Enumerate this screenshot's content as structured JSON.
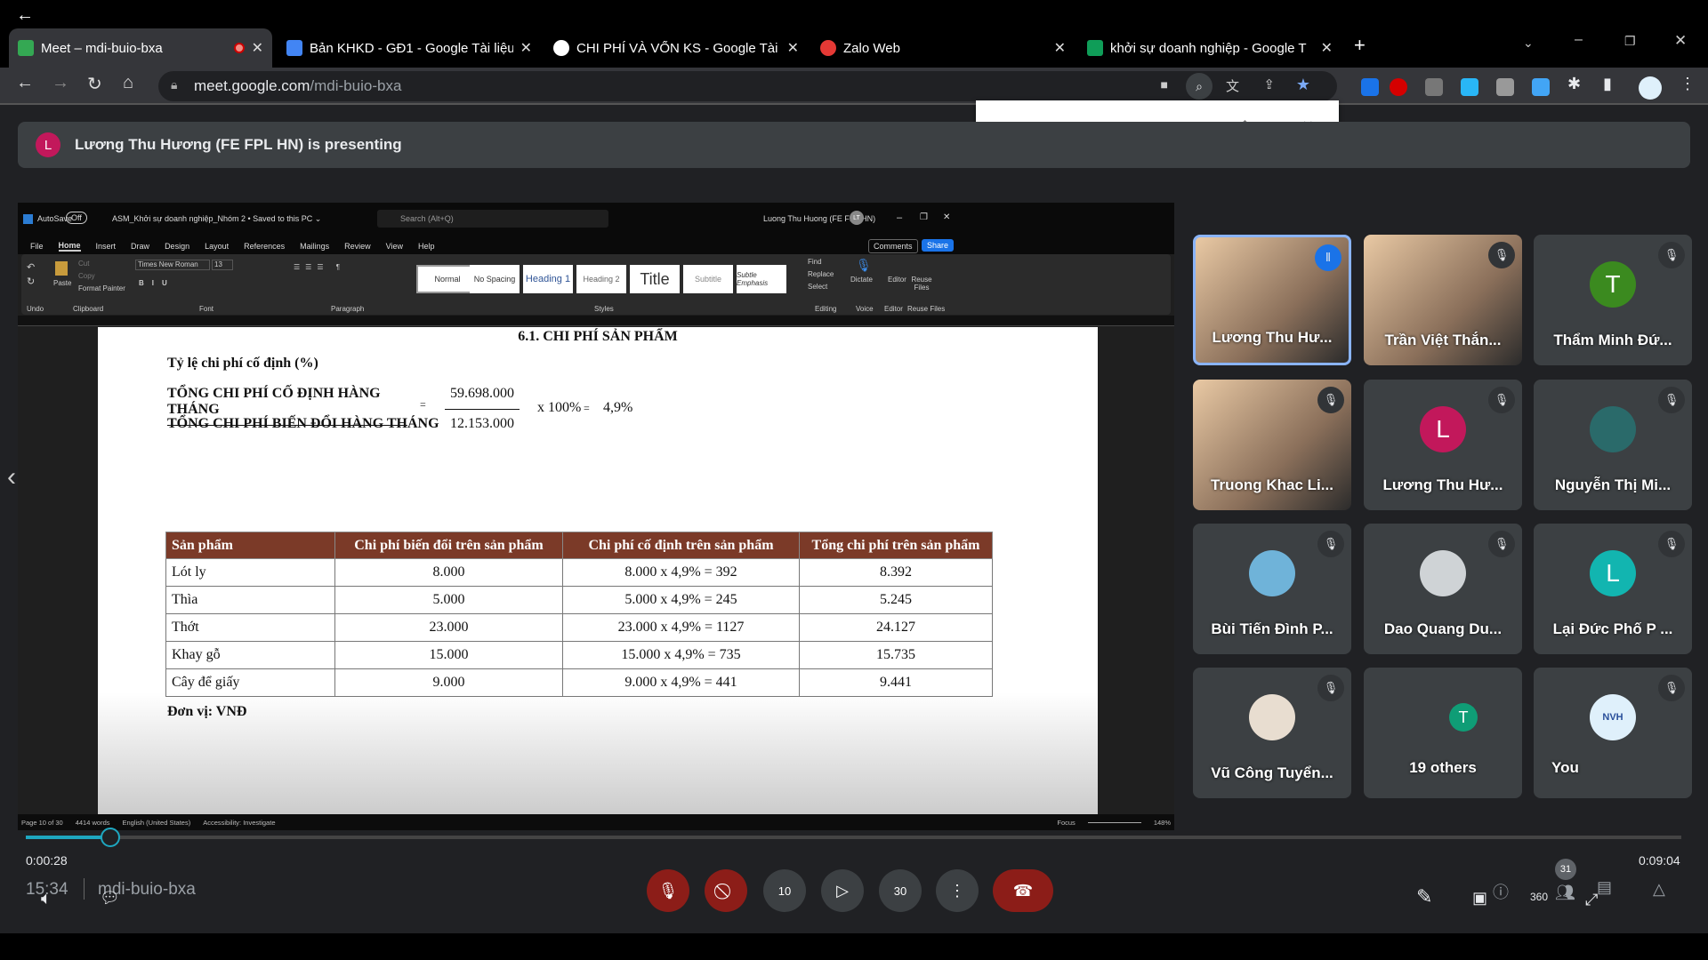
{
  "browser": {
    "tabs": [
      {
        "label": "Meet – mdi-buio-bxa",
        "color": "#34a853",
        "active": true
      },
      {
        "label": "Bản KHKD - GĐ1 - Google Tài liệu",
        "color": "#4285f4"
      },
      {
        "label": "CHI PHÍ VÀ VỐN KS - Google Tài",
        "color": "#ffffff"
      },
      {
        "label": "Zalo Web",
        "color": "#e53935"
      },
      {
        "label": "khởi sự doanh nghiệp - Google T",
        "color": "#0f9d58"
      }
    ],
    "url_host": "meet.google.com",
    "url_path": "/mdi-buio-bxa"
  },
  "banner": {
    "avatar": "L",
    "text": "Lương Thu Hương (FE FPL HN) is presenting"
  },
  "word": {
    "autosave": "AutoSave",
    "autosave_state": "Off",
    "doc_title": "ASM_Khởi sự doanh nghiệp_Nhóm 2 • Saved to this PC ⌄",
    "search": "Search (Alt+Q)",
    "user": "Luong Thu Huong (FE FPL HN)",
    "user_initials": "LT",
    "menu": [
      "File",
      "Home",
      "Insert",
      "Draw",
      "Design",
      "Layout",
      "References",
      "Mailings",
      "Review",
      "View",
      "Help"
    ],
    "comments": "Comments",
    "share": "Share",
    "font": "Times New Roman",
    "size": "13",
    "clipboard": {
      "paste": "Paste",
      "cut": "Cut",
      "copy": "Copy",
      "format_painter": "Format Painter"
    },
    "styles": [
      "Normal",
      "No Spacing",
      "Heading 1",
      "Heading 2",
      "Title",
      "Subtitle",
      "Subtle Emphasis"
    ],
    "editing": [
      "Find",
      "Replace",
      "Select"
    ],
    "voice": "Dictate",
    "editor": "Editor",
    "reuse": "Reuse Files",
    "groups": [
      "Undo",
      "Clipboard",
      "Font",
      "Paragraph",
      "Styles",
      "Editing",
      "Voice",
      "Editor",
      "Reuse Files"
    ],
    "status": {
      "page": "Page 10 of 30",
      "words": "4414 words",
      "lang": "English (United States)",
      "access": "Accessibility: Investigate",
      "focus": "Focus",
      "zoom": "148%"
    }
  },
  "doc": {
    "heading": "6.1. CHI PHÍ SẢN PHẨM",
    "subheading": "Tỷ lệ chi phí cố định (%)",
    "formula": {
      "num_label": "TỔNG CHI PHÍ CỐ ĐỊNH HÀNG THÁNG",
      "den_label": "TỔNG CHI PHÍ BIẾN ĐỔI HÀNG THÁNG",
      "num": "59.698.000",
      "den": "12.153.000",
      "eq": "=",
      "mult": "x 100%",
      "result": "4,9%"
    },
    "table": {
      "headers": [
        "Sản phẩm",
        "Chi phí biến đổi trên sản phẩm",
        "Chi phí cố định trên sản phẩm",
        "Tổng chi phí trên sản phẩm"
      ],
      "rows": [
        [
          "Lót ly",
          "8.000",
          "8.000 x 4,9% = 392",
          "8.392"
        ],
        [
          "Thìa",
          "5.000",
          "5.000 x 4,9% = 245",
          "5.245"
        ],
        [
          "Thớt",
          "23.000",
          "23.000 x 4,9% = 1127",
          "24.127"
        ],
        [
          "Khay gỗ",
          "15.000",
          "15.000 x 4,9% = 735",
          "15.735"
        ],
        [
          "Cây để giấy",
          "9.000",
          "9.000 x 4,9% = 441",
          "9.441"
        ]
      ]
    },
    "unit": "Đơn vị: VNĐ"
  },
  "participants": [
    {
      "name": "Lương Thu Hư...",
      "video": true,
      "speaking": true
    },
    {
      "name": "Trần Việt Thắn...",
      "video": true,
      "muted": true
    },
    {
      "name": "Thẩm Minh Đứ...",
      "initial": "T",
      "color": "#3b8a1f",
      "muted": true
    },
    {
      "name": "Truong Khac Li...",
      "video": true,
      "muted": true
    },
    {
      "name": "Lương Thu Hư...",
      "initial": "L",
      "color": "#c2185b",
      "muted": true
    },
    {
      "name": "Nguyễn Thị Mi...",
      "color": "#2a6a6a",
      "muted": true
    },
    {
      "name": "Bùi Tiến Đình P...",
      "color": "#6fb3d9",
      "muted": true
    },
    {
      "name": "Dao Quang Du...",
      "color": "#cfd3d6",
      "muted": true
    },
    {
      "name": "Lại Đức Phố P ...",
      "initial": "L",
      "color": "#12b5b0",
      "muted": true
    },
    {
      "name": "Vũ Công Tuyển...",
      "color": "#e8ddd0",
      "muted": true
    },
    {
      "name": "19 others",
      "initial": "T",
      "color": "#0f9d76"
    },
    {
      "name": "You",
      "initials_logo": "NVH",
      "color": "#dff0fb",
      "muted": true
    }
  ],
  "player": {
    "elapsed": "0:00:28",
    "total": "0:09:04",
    "progress_pct": 5.1,
    "clock": "15:34",
    "meeting_code": "mdi-buio-bxa",
    "skip_back": "10",
    "skip_fwd": "30",
    "badge": "31",
    "vr": "360"
  }
}
